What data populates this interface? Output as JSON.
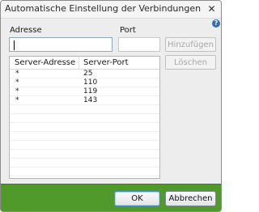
{
  "window": {
    "title": "Automatische Einstellung der Verbindungen",
    "close_icon": "close-icon",
    "help_icon": "help-icon",
    "help_glyph": "?",
    "close_glyph": "✕"
  },
  "form": {
    "address_label": "Adresse",
    "address_value": "",
    "port_label": "Port",
    "port_value": ""
  },
  "buttons": {
    "add": "Hinzufügen",
    "delete": "Löschen",
    "ok": "OK",
    "cancel": "Abbrechen"
  },
  "list": {
    "columns": [
      "Server-Adresse",
      "Server-Port"
    ],
    "rows": [
      [
        "*",
        "25"
      ],
      [
        "*",
        "110"
      ],
      [
        "*",
        "119"
      ],
      [
        "*",
        "143"
      ]
    ]
  },
  "colors": {
    "footer": "#4f9a2a",
    "help": "#2f6fb8"
  }
}
